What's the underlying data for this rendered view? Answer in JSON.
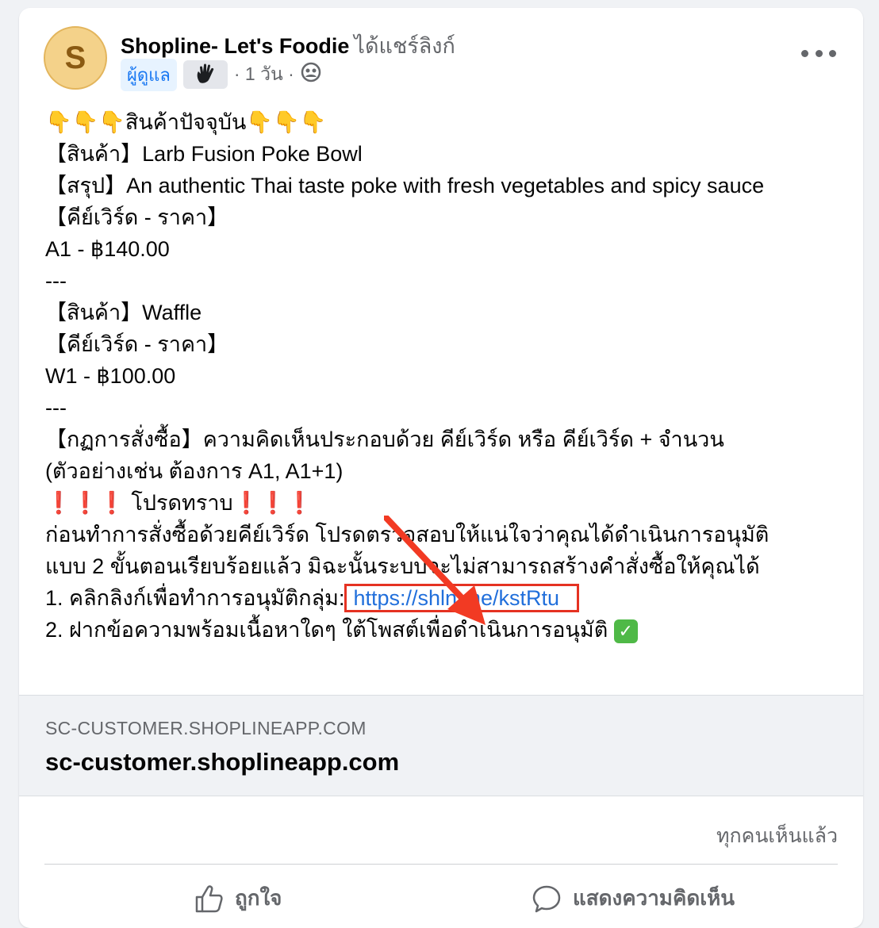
{
  "post": {
    "avatar_letter": "S",
    "page_name": "Shopline- Let's Foodie",
    "shared_text": "ได้แชร์ลิงก์",
    "admin_badge": "ผู้ดูแล",
    "time": "· 1 วัน ·",
    "audience_icon": "group-icon",
    "body": {
      "line1_fingers_left": "👇👇👇",
      "line1_text": "สินค้าปัจจุบัน",
      "line1_fingers_right": "👇👇👇",
      "line2": "【สินค้า】Larb Fusion Poke Bowl",
      "line3": "【สรุป】An authentic Thai taste poke with fresh vegetables and spicy sauce",
      "line4": "【คีย์เวิร์ด - ราคา】",
      "line5": "A1 - ฿140.00",
      "line6": "---",
      "line7": "【สินค้า】Waffle",
      "line8": "【คีย์เวิร์ด - ราคา】",
      "line9": "W1 - ฿100.00",
      "line10": "---",
      "line11": "【กฏการสั่งซื้อ】ความคิดเห็นประกอบด้วย คีย์เวิร์ด หรือ  คีย์เวิร์ด + จำนวน",
      "line12": "(ตัวอย่างเช่น ต้องการ A1, A1+1)",
      "line13_bangs_left": "❗❗❗",
      "line13_text": "โปรดทราบ",
      "line13_bangs_right": "❗❗❗",
      "line14": "ก่อนทำการสั่งซื้อด้วยคีย์เวิร์ด โปรดตรวจสอบให้แน่ใจว่าคุณได้ดำเนินการอนุมัติ",
      "line15": "แบบ 2 ขั้นตอนเรียบร้อยแล้ว มิฉะนั้นระบบจะไม่สามารถสร้างคำสั่งซื้อให้คุณได้",
      "line16_prefix": "1. คลิกลิงก์เพื่อทำการอนุมัติกลุ่ม:",
      "line16_link": "https://shln.me/kstRtu",
      "line17": "2. ฝากข้อความพร้อมเนื้อหาใดๆ ใต้โพสต์เพื่อดำเนินการอนุมัติ",
      "line17_check": "✓"
    },
    "preview": {
      "domain": "SC-CUSTOMER.SHOPLINEAPP.COM",
      "title": "sc-customer.shoplineapp.com"
    },
    "seen_by": "ทุกคนเห็นแล้ว",
    "actions": {
      "like": "ถูกใจ",
      "comment": "แสดงความคิดเห็น"
    }
  },
  "colors": {
    "link": "#216fdb",
    "highlight_box": "#e53222",
    "annotation_arrow": "#f23a23"
  }
}
